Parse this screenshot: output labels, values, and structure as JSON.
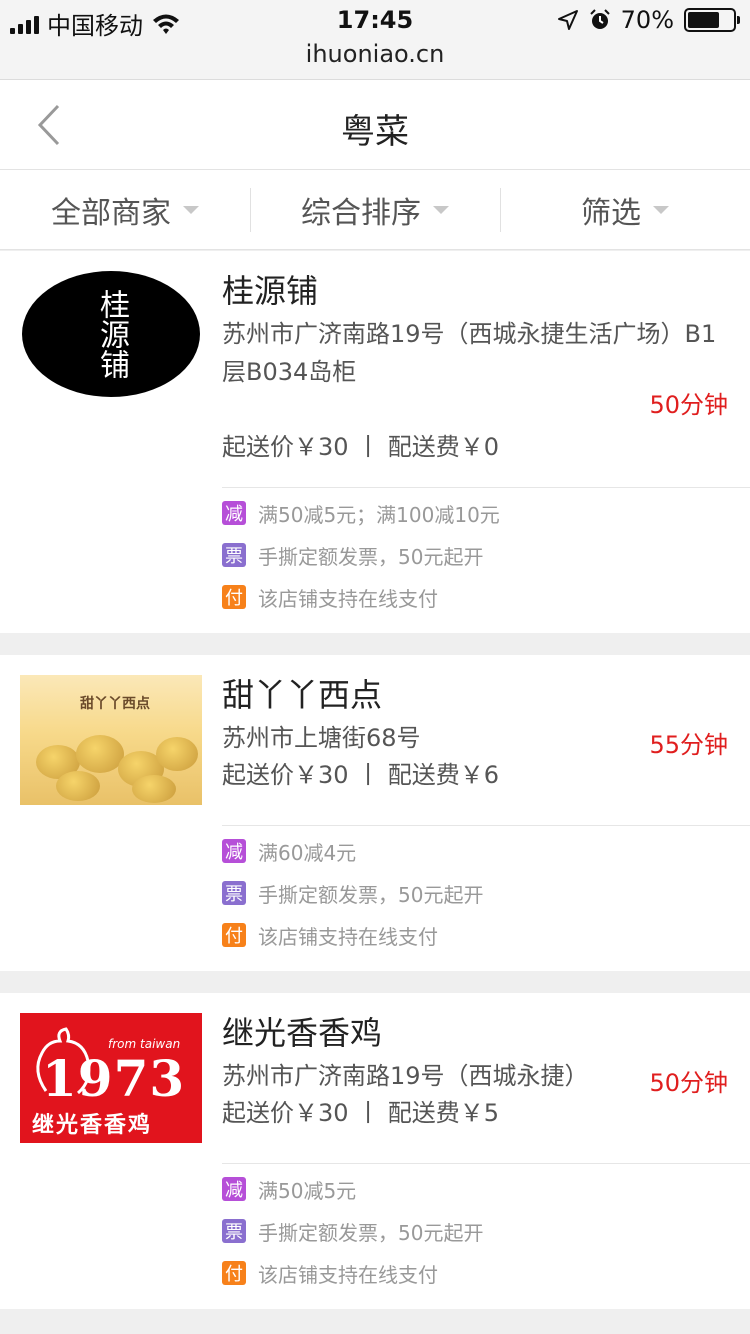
{
  "status_bar": {
    "carrier": "中国移动",
    "time": "17:45",
    "url": "ihuoniao.cn",
    "battery": "70%",
    "battery_level": 0.7
  },
  "header": {
    "title": "粤菜"
  },
  "filters": [
    {
      "label": "全部商家"
    },
    {
      "label": "综合排序"
    },
    {
      "label": "筛选"
    }
  ],
  "shops": [
    {
      "name": "桂源铺",
      "address": "苏州市广济南路19号（西城永捷生活广场）B1层B034岛柜",
      "delivery_time": "50分钟",
      "price_line": "起送价￥30  丨 配送费￥0",
      "logo_text": "桂源铺",
      "promos": [
        {
          "tag": "减",
          "text": "满50减5元；满100减10元"
        },
        {
          "tag": "票",
          "text": "手撕定额发票，50元起开"
        },
        {
          "tag": "付",
          "text": "该店铺支持在线支付"
        }
      ]
    },
    {
      "name": "甜丫丫西点",
      "address": "苏州市上塘街68号",
      "delivery_time": "55分钟",
      "price_line": "起送价￥30  丨 配送费￥6",
      "logo_text": "甜丫丫西点",
      "promos": [
        {
          "tag": "减",
          "text": "满60减4元"
        },
        {
          "tag": "票",
          "text": "手撕定额发票，50元起开"
        },
        {
          "tag": "付",
          "text": "该店铺支持在线支付"
        }
      ]
    },
    {
      "name": "继光香香鸡",
      "address": "苏州市广济南路19号（西城永捷）",
      "delivery_time": "50分钟",
      "price_line": "起送价￥30  丨 配送费￥5",
      "logo_number": "1973",
      "logo_from": "from taiwan",
      "logo_text": "继光香香鸡",
      "promos": [
        {
          "tag": "减",
          "text": "满50减5元"
        },
        {
          "tag": "票",
          "text": "手撕定额发票，50元起开"
        },
        {
          "tag": "付",
          "text": "该店铺支持在线支付"
        }
      ]
    }
  ]
}
